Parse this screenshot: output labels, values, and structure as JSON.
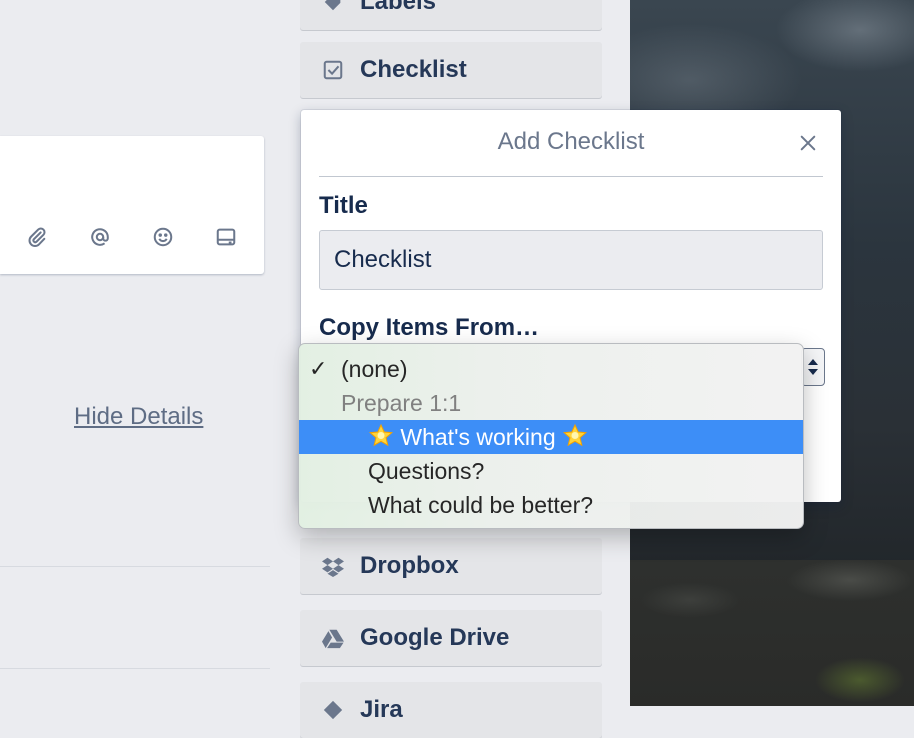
{
  "sidebar": {
    "labels": "Labels",
    "checklist": "Checklist",
    "dropbox": "Dropbox",
    "google_drive": "Google Drive",
    "jira": "Jira"
  },
  "card": {
    "hide_details": "Hide Details"
  },
  "popover": {
    "title": "Add Checklist",
    "title_field_label": "Title",
    "title_value": "Checklist",
    "copy_label": "Copy Items From…"
  },
  "dropdown": {
    "none": "(none)",
    "group": "Prepare 1:1",
    "items": [
      {
        "label": "What's working",
        "selected": true,
        "icon": "star-emoji"
      },
      {
        "label": "Questions?",
        "selected": false
      },
      {
        "label": "What could be better?",
        "selected": false
      }
    ]
  },
  "colors": {
    "highlight": "#3d8ef7",
    "button_bg": "#e4e5e8"
  }
}
